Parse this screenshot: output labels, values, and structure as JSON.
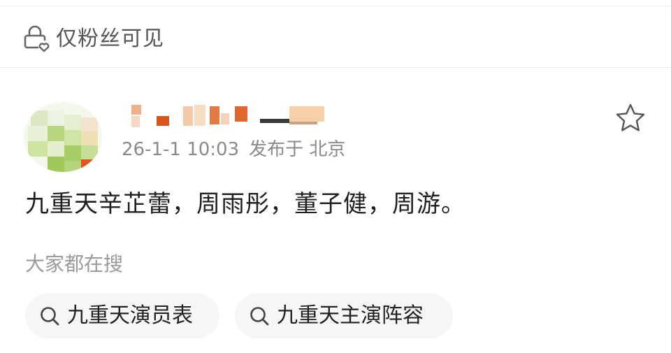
{
  "visibility": {
    "label": "仅粉丝可见",
    "icon": "lock-heart-icon"
  },
  "post": {
    "timestamp": "26-1-1 10:03",
    "location": "发布于 北京",
    "content": "九重天辛芷蕾，周雨彤，董子健，周游。",
    "favorite_icon": "star-outline-icon"
  },
  "search": {
    "label": "大家都在搜",
    "chips": [
      {
        "label": "九重天演员表",
        "icon": "search-icon"
      },
      {
        "label": "九重天主演阵容",
        "icon": "search-icon"
      }
    ]
  },
  "colors": {
    "muted_text": "#8a8a8a",
    "primary_text": "#1f1f1f",
    "chip_background": "#f6f6f6"
  }
}
